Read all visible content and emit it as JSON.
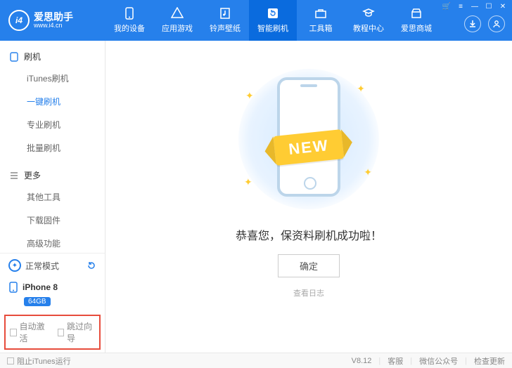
{
  "app": {
    "name": "爱思助手",
    "site": "www.i4.cn",
    "logo_text": "i4"
  },
  "window_controls": [
    "🛒",
    "≡",
    "—",
    "☐",
    "✕"
  ],
  "nav": [
    {
      "id": "device",
      "label": "我的设备",
      "icon": "phone-icon"
    },
    {
      "id": "apps",
      "label": "应用游戏",
      "icon": "apps-icon"
    },
    {
      "id": "ring",
      "label": "铃声壁纸",
      "icon": "music-icon"
    },
    {
      "id": "flash",
      "label": "智能刷机",
      "icon": "refresh-icon",
      "active": true
    },
    {
      "id": "toolbox",
      "label": "工具箱",
      "icon": "toolbox-icon"
    },
    {
      "id": "tutorial",
      "label": "教程中心",
      "icon": "tutorial-icon"
    },
    {
      "id": "store",
      "label": "爱思商城",
      "icon": "store-icon"
    }
  ],
  "header_right": [
    {
      "id": "download",
      "icon": "download-icon"
    },
    {
      "id": "user",
      "icon": "user-icon"
    }
  ],
  "sidebar": {
    "groups": [
      {
        "id": "flash",
        "title": "刷机",
        "icon": "phone-outline-icon",
        "items": [
          {
            "id": "itunes-flash",
            "label": "iTunes刷机"
          },
          {
            "id": "one-key-flash",
            "label": "一键刷机",
            "active": true
          },
          {
            "id": "pro-flash",
            "label": "专业刷机"
          },
          {
            "id": "batch-flash",
            "label": "批量刷机"
          }
        ]
      },
      {
        "id": "more",
        "title": "更多",
        "icon": "hamburger-icon",
        "items": [
          {
            "id": "other-tools",
            "label": "其他工具"
          },
          {
            "id": "download-fw",
            "label": "下载固件"
          },
          {
            "id": "advanced",
            "label": "高级功能"
          }
        ]
      }
    ],
    "mode": {
      "label": "正常模式"
    },
    "device": {
      "name": "iPhone 8",
      "badge": "64GB"
    },
    "options": [
      {
        "id": "auto-activate",
        "label": "自动激活"
      },
      {
        "id": "skip-guide",
        "label": "跳过向导"
      }
    ]
  },
  "main": {
    "ribbon": "NEW",
    "congrats": "恭喜您，保资料刷机成功啦！",
    "ok": "确定",
    "view_log": "查看日志"
  },
  "footer": {
    "block_itunes": "阻止iTunes运行",
    "version": "V8.12",
    "links": [
      "客服",
      "微信公众号",
      "检查更新"
    ]
  }
}
